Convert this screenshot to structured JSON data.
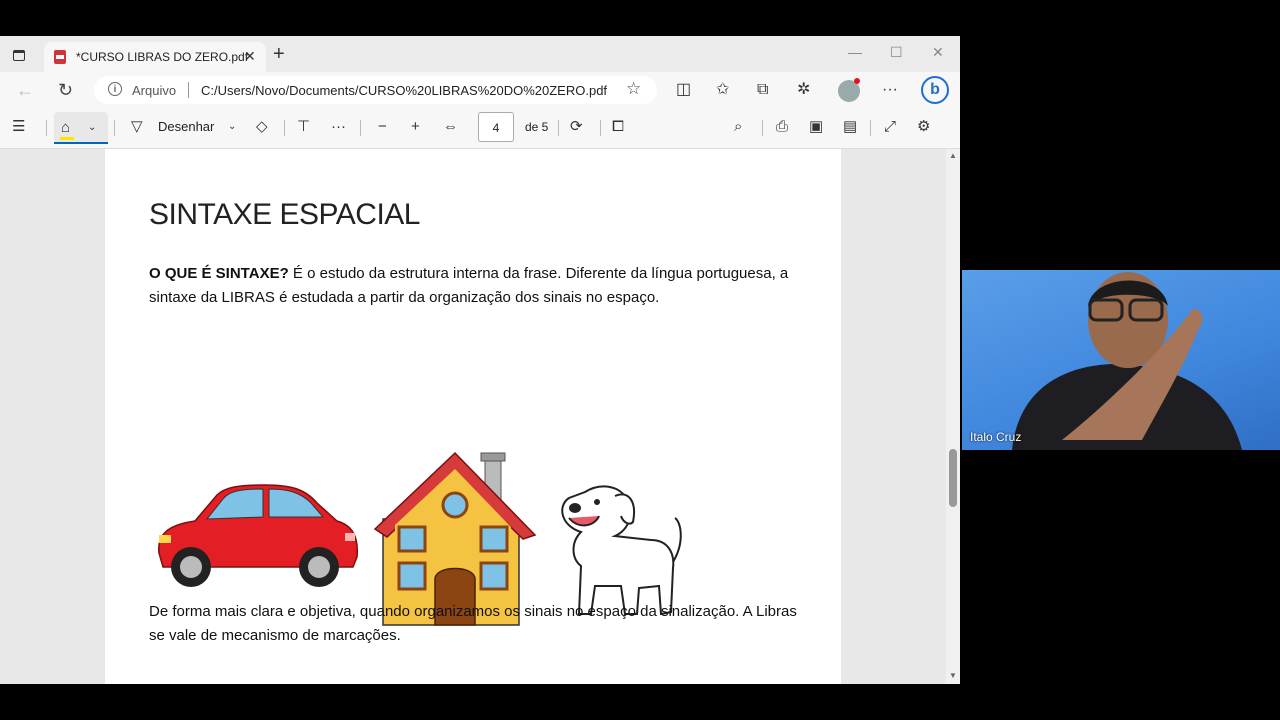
{
  "tab": {
    "title": "*CURSO LIBRAS DO ZERO.pdf"
  },
  "address": {
    "label": "Arquivo",
    "url": "C:/Users/Novo/Documents/CURSO%20LIBRAS%20DO%20ZERO.pdf"
  },
  "toolbar": {
    "draw_label": "Desenhar",
    "page_current": "4",
    "page_total": "de 5"
  },
  "document": {
    "title": "SINTAXE ESPACIAL",
    "p1_bold": "O QUE É SINTAXE?",
    "p1_text": " É o estudo da estrutura interna da frase. Diferente da língua portuguesa, a sintaxe da LIBRAS é estudada a partir da organização dos sinais no espaço.",
    "p2_text": "De forma mais clara e objetiva, quando organizamos os sinais no espaço da sinalização. A Libras se vale de mecanismo de marcações."
  },
  "video": {
    "participant": "Italo Cruz"
  },
  "colors": {
    "car": "#e31e24",
    "house": "#f5c342",
    "roof": "#d63a3a",
    "accent": "#0067c0"
  }
}
